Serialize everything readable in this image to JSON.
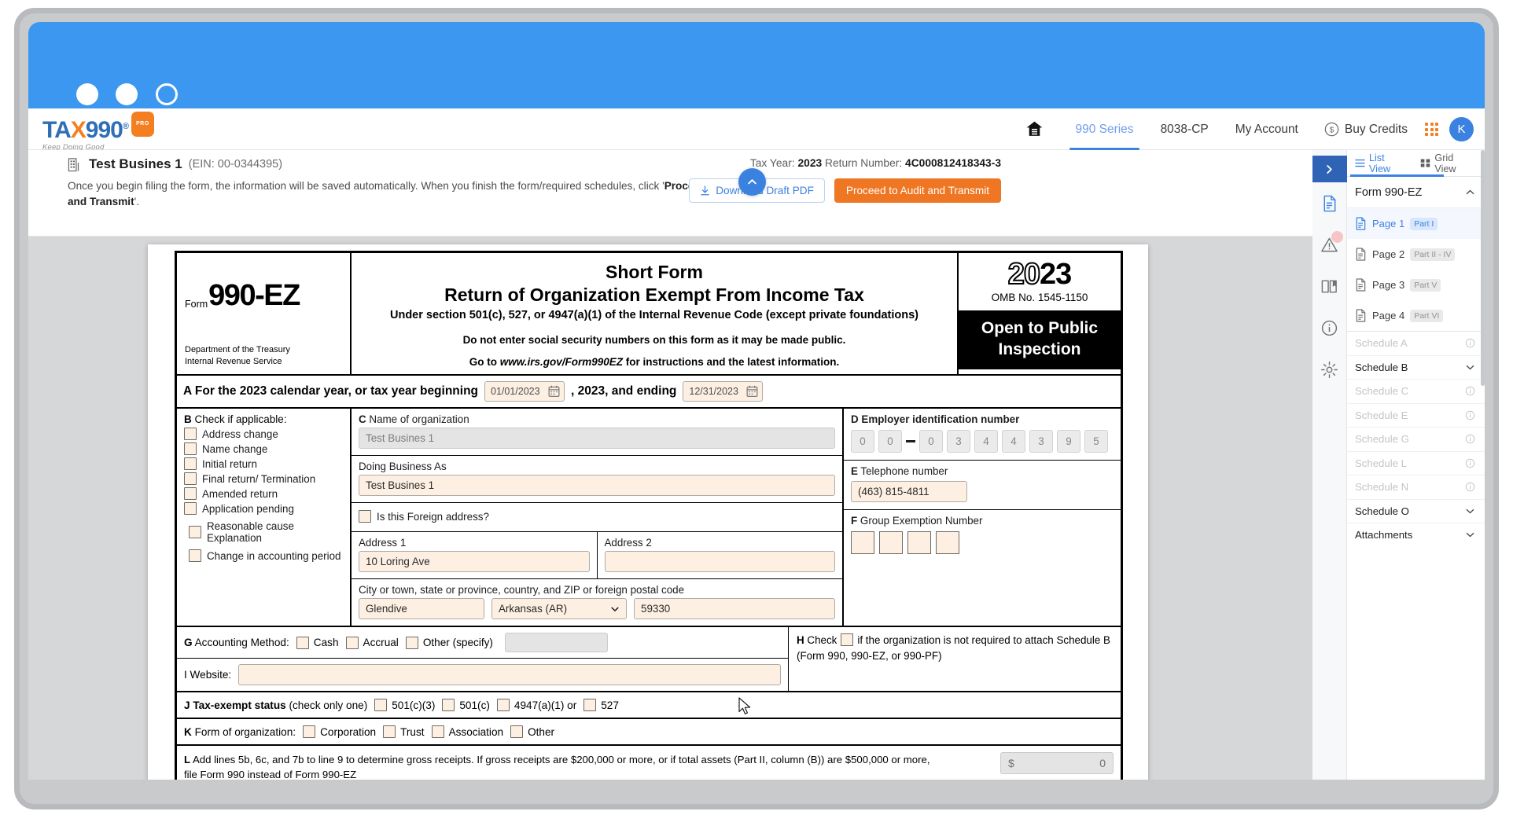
{
  "window": {
    "title": ""
  },
  "appnav": {
    "brand": {
      "tax": "TA",
      "x": "X",
      "num": "990",
      "reg": "®",
      "pro": "PRO",
      "tagline": "Keep Doing Good"
    },
    "home_icon": "home-icon",
    "items": [
      {
        "label": "990 Series",
        "active": true
      },
      {
        "label": "8038-CP",
        "active": false
      },
      {
        "label": "My Account",
        "active": false
      }
    ],
    "buy_credits": "Buy Credits",
    "avatar_initial": "K"
  },
  "subheader": {
    "business_name": "Test Busines 1",
    "ein": "(EIN: 00-0344395)",
    "note_pre": "Once you begin filing the form, the information will be saved automatically. When you finish the form/required schedules, click '",
    "note_bold": "Proceed to Audit and Transmit",
    "note_post": "'.",
    "tax_year_label": "Tax Year:",
    "tax_year_value": "2023",
    "return_number_label": "Return Number:",
    "return_number_value": "4C000812418343-3",
    "download_button": "Download Draft PDF",
    "transmit_button": "Proceed to Audit and Transmit"
  },
  "form": {
    "header": {
      "form_word": "Form",
      "form_number": "990-EZ",
      "dept_line1": "Department of the Treasury",
      "dept_line2": "Internal Revenue Service",
      "title1": "Short Form",
      "title2": "Return of Organization Exempt From Income Tax",
      "subtitle": "Under section 501(c), 527, or 4947(a)(1) of the Internal Revenue Code (except private foundations)",
      "notice": "Do not enter social security numbers on this form as it may be made public.",
      "goto_pre": "Go to ",
      "goto_url": "www.irs.gov/Form990EZ",
      "goto_post": " for instructions and the latest information.",
      "year_hollow": "20",
      "year_solid": "23",
      "omb": "OMB No. 1545-1150",
      "open_public": "Open to Public Inspection"
    },
    "rowA": {
      "text_pre": "A For the 2023 calendar year, or tax year beginning",
      "begin_date": "01/01/2023",
      "text_mid": ", 2023, and ending",
      "end_date": "12/31/2023"
    },
    "sectionB": {
      "letter": "B",
      "title": " Check if applicable:",
      "items": [
        "Address change",
        "Name change",
        "Initial return",
        "Final return/ Termination",
        "Amended return",
        "Application pending"
      ],
      "indented": [
        "Reasonable cause Explanation",
        "Change in accounting period"
      ]
    },
    "sectionC": {
      "letter": "C",
      "name_label": " Name of organization",
      "name_value": "Test Busines 1",
      "dba_label": "Doing Business As",
      "dba_value": "Test Busines 1",
      "foreign_label": "Is this Foreign address?",
      "addr1_label": "Address 1",
      "addr1_value": "10 Loring Ave",
      "addr2_label": "Address 2",
      "addr2_value": "",
      "city_label": "City or town, state or province, country, and ZIP or foreign postal code",
      "city_value": "Glendive",
      "state_value": "Arkansas (AR)",
      "zip_value": "59330"
    },
    "sectionD": {
      "letter": "D",
      "label": " Employer identification number",
      "digits": [
        "0",
        "0",
        "0",
        "3",
        "4",
        "4",
        "3",
        "9",
        "5"
      ]
    },
    "sectionE": {
      "letter": "E",
      "label": " Telephone number",
      "value": "(463) 815-4811"
    },
    "sectionF": {
      "letter": "F",
      "label": " Group Exemption Number",
      "boxes": [
        "",
        "",
        "",
        ""
      ]
    },
    "sectionG": {
      "letter": "G",
      "label": " Accounting Method:",
      "options": [
        "Cash",
        "Accrual",
        "Other (specify)"
      ],
      "other_value": ""
    },
    "sectionH": {
      "letter": "H",
      "text_pre": " Check",
      "text_post": "if the organization is not required to attach Schedule B (Form 990, 990-EZ, or 990-PF)"
    },
    "sectionI": {
      "letter": "I Website:",
      "value": ""
    },
    "sectionJ": {
      "letter": "J",
      "bold": " Tax-exempt status",
      "hint": " (check only one)",
      "options": [
        "501(c)(3)",
        "501(c)",
        "4947(a)(1) or",
        "527"
      ]
    },
    "sectionK": {
      "letter": "K",
      "label": " Form of organization:",
      "options": [
        "Corporation",
        "Trust",
        "Association",
        "Other"
      ]
    },
    "sectionL": {
      "letter": "L",
      "line1": " Add lines 5b, 6c, and 7b to line 9 to determine gross receipts. If gross receipts are $200,000 or more, or if total assets (Part II, column (B)) are $500,000 or more,",
      "line2": "file Form 990 instead of Form 990-EZ",
      "currency": "$",
      "amount": "0"
    }
  },
  "panel": {
    "view_tabs": [
      {
        "label": "List View",
        "active": true
      },
      {
        "label": "Grid View",
        "active": false
      }
    ],
    "title": "Form 990-EZ",
    "pages": [
      {
        "label": "Page 1",
        "tag": "Part I",
        "active": true
      },
      {
        "label": "Page 2",
        "tag": "Part II - IV",
        "active": false
      },
      {
        "label": "Page 3",
        "tag": "Part V",
        "active": false
      },
      {
        "label": "Page 4",
        "tag": "Part VI",
        "active": false
      }
    ],
    "schedules": [
      {
        "label": "Schedule A",
        "state": "dim",
        "right": "info"
      },
      {
        "label": "Schedule B",
        "state": "on",
        "right": "chevron"
      },
      {
        "label": "Schedule C",
        "state": "dim",
        "right": "info"
      },
      {
        "label": "Schedule E",
        "state": "dim",
        "right": "info"
      },
      {
        "label": "Schedule G",
        "state": "dim",
        "right": "info"
      },
      {
        "label": "Schedule L",
        "state": "dim",
        "right": "info"
      },
      {
        "label": "Schedule N",
        "state": "dim",
        "right": "info"
      },
      {
        "label": "Schedule O",
        "state": "on",
        "right": "chevron"
      },
      {
        "label": "Attachments",
        "state": "on",
        "right": "chevron"
      }
    ]
  },
  "colors": {
    "brand_blue": "#3b82e0",
    "title_bar": "#3b97ef",
    "accent_orange": "#ef7622",
    "field_bg": "#fdf0e2",
    "disabled_bg": "#e4e4e4"
  }
}
